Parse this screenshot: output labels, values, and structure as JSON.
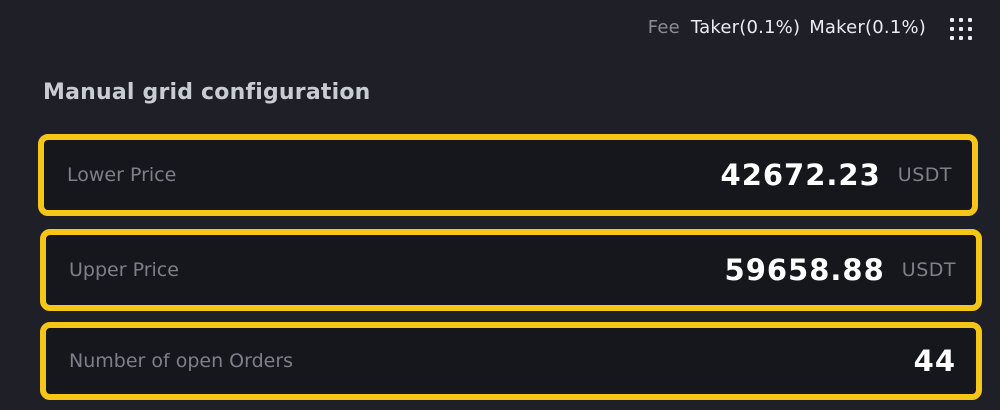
{
  "header": {
    "fee_label": "Fee",
    "taker_fee": "Taker(0.1%)",
    "maker_fee": "Maker(0.1%)",
    "menu_icon": "grid-dots-icon"
  },
  "section": {
    "title": "Manual grid configuration"
  },
  "fields": {
    "lower_price": {
      "label": "Lower Price",
      "value": "42672.23",
      "unit": "USDT"
    },
    "upper_price": {
      "label": "Upper Price",
      "value": "59658.88",
      "unit": "USDT"
    },
    "open_orders": {
      "label": "Number of open Orders",
      "value": "44"
    }
  },
  "colors": {
    "background": "#1f2027",
    "highlight": "#f5c518",
    "field_bg": "#16171c"
  }
}
